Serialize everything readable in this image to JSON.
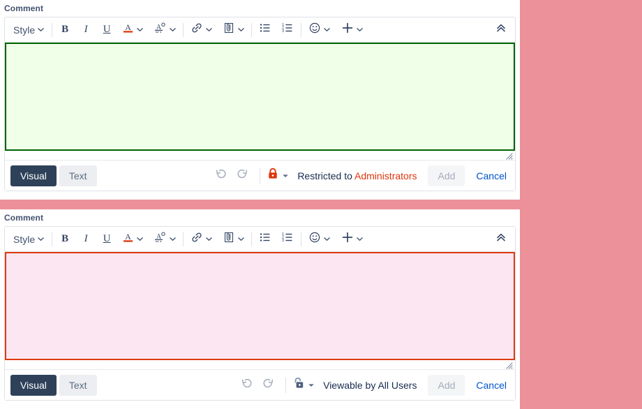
{
  "colors": {
    "page_background": "#ec9099",
    "panel_background": "#ffffff",
    "editor1_border": "#006400",
    "editor1_fill": "#f0ffe8",
    "editor2_border": "#dd3c10",
    "editor2_fill": "#fce6f2",
    "active_tab": "#2e4159",
    "link": "#0052cc",
    "restricted_accent": "#de350b",
    "toolbar_icon": "#344563"
  },
  "toolbar": {
    "style_label": "Style",
    "bold_label": "B",
    "italic_label": "I",
    "underline_label": "U",
    "text_color_label": "A",
    "items": [
      {
        "name": "style-dropdown",
        "label": "Style"
      },
      {
        "name": "bold-button",
        "label": "B"
      },
      {
        "name": "italic-button",
        "label": "I"
      },
      {
        "name": "underline-button",
        "label": "U"
      },
      {
        "name": "text-color-button",
        "label": "A"
      },
      {
        "name": "highlight-color-button",
        "label": ""
      },
      {
        "name": "link-button",
        "label": ""
      },
      {
        "name": "attachment-button",
        "label": ""
      },
      {
        "name": "bullet-list-button",
        "label": ""
      },
      {
        "name": "numbered-list-button",
        "label": ""
      },
      {
        "name": "emoji-button",
        "label": ""
      },
      {
        "name": "insert-more-button",
        "label": ""
      },
      {
        "name": "collapse-toolbar-button",
        "label": ""
      }
    ]
  },
  "editors": [
    {
      "field_label": "Comment",
      "body_text": "",
      "body_placeholder": "",
      "tabs": {
        "visual": "Visual",
        "text": "Text"
      },
      "active_tab": "Visual",
      "restriction": {
        "icon": "lock-closed-icon",
        "prefix": "Restricted to ",
        "accent": "Administrators",
        "full_text": "Restricted to Administrators"
      },
      "add_label": "Add",
      "cancel_label": "Cancel",
      "add_enabled": false
    },
    {
      "field_label": "Comment",
      "body_text": "",
      "body_placeholder": "",
      "tabs": {
        "visual": "Visual",
        "text": "Text"
      },
      "active_tab": "Visual",
      "restriction": {
        "icon": "lock-open-icon",
        "prefix": "Viewable by All Users",
        "accent": "",
        "full_text": "Viewable by All Users"
      },
      "add_label": "Add",
      "cancel_label": "Cancel",
      "add_enabled": false
    }
  ]
}
